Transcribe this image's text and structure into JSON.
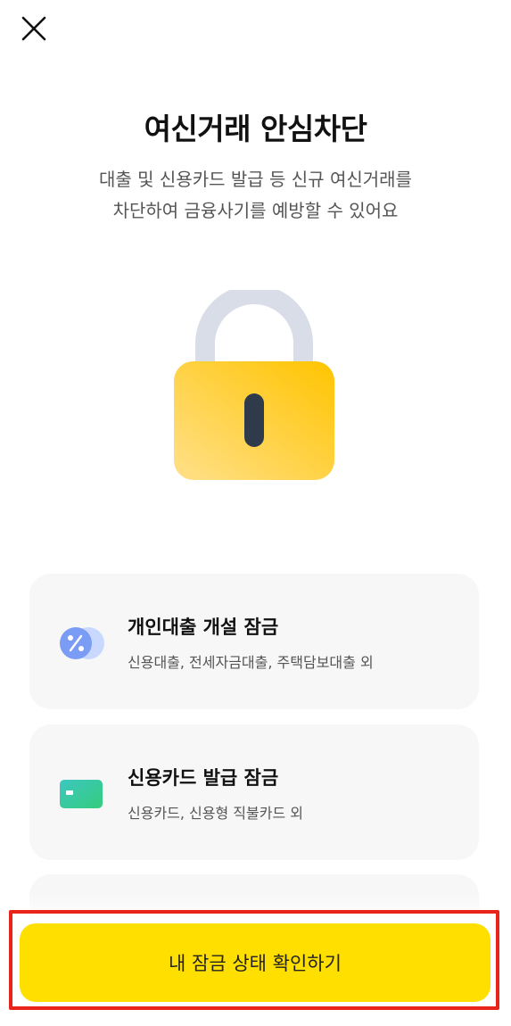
{
  "header": {
    "close_icon": "close-icon"
  },
  "hero": {
    "title": "여신거래 안심차단",
    "subtitle_line1": "대출 및 신용카드 발급 등 신규 여신거래를",
    "subtitle_line2": "차단하여 금융사기를 예방할 수 있어요",
    "illustration": "padlock-icon",
    "colors": {
      "lock_body_start": "#ffe08a",
      "lock_body_end": "#ffc400",
      "shackle": "#d9dde8",
      "keyhole": "#2f3a4b"
    }
  },
  "items": [
    {
      "icon": "percent-coin-icon",
      "title": "개인대출 개설 잠금",
      "desc": "신용대출, 전세자금대출, 주택담보대출 외"
    },
    {
      "icon": "credit-card-icon",
      "title": "신용카드 발급 잠금",
      "desc": "신용카드, 신용형 직불카드 외"
    }
  ],
  "cta": {
    "label": "내 잠금 상태 확인하기",
    "color": "#ffdf00",
    "highlight_color": "#e8231a"
  }
}
